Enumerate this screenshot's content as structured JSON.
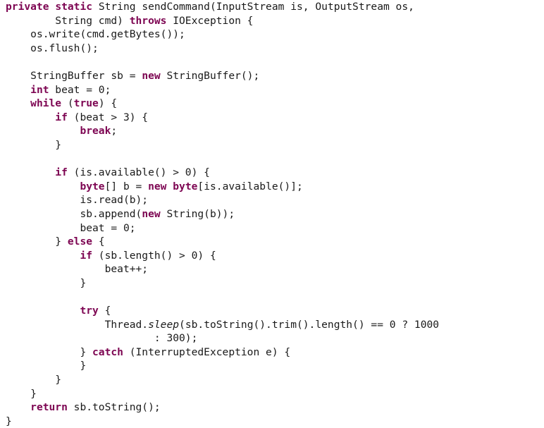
{
  "editor": {
    "language": "java",
    "background_color": "#ffffff",
    "text_color": "#1a1a1a",
    "keyword_color": "#7d0552",
    "font_size_px": 14.6,
    "line_height_px": 19.6
  },
  "code": {
    "lines": [
      {
        "indent": 0,
        "tokens": [
          {
            "t": "kw",
            "s": "private"
          },
          {
            "t": "plain",
            "s": " "
          },
          {
            "t": "kw",
            "s": "static"
          },
          {
            "t": "plain",
            "s": " String sendCommand(InputStream is, OutputStream os,"
          }
        ]
      },
      {
        "indent": 8,
        "tokens": [
          {
            "t": "plain",
            "s": "String cmd) "
          },
          {
            "t": "kw",
            "s": "throws"
          },
          {
            "t": "plain",
            "s": " IOException {"
          }
        ]
      },
      {
        "indent": 4,
        "tokens": [
          {
            "t": "plain",
            "s": "os.write(cmd.getBytes());"
          }
        ]
      },
      {
        "indent": 4,
        "tokens": [
          {
            "t": "plain",
            "s": "os.flush();"
          }
        ]
      },
      {
        "indent": 0,
        "tokens": []
      },
      {
        "indent": 4,
        "tokens": [
          {
            "t": "plain",
            "s": "StringBuffer sb = "
          },
          {
            "t": "kw",
            "s": "new"
          },
          {
            "t": "plain",
            "s": " StringBuffer();"
          }
        ]
      },
      {
        "indent": 4,
        "tokens": [
          {
            "t": "kw",
            "s": "int"
          },
          {
            "t": "plain",
            "s": " beat = 0;"
          }
        ]
      },
      {
        "indent": 4,
        "tokens": [
          {
            "t": "kw",
            "s": "while"
          },
          {
            "t": "plain",
            "s": " ("
          },
          {
            "t": "kw",
            "s": "true"
          },
          {
            "t": "plain",
            "s": ") {"
          }
        ]
      },
      {
        "indent": 8,
        "tokens": [
          {
            "t": "kw",
            "s": "if"
          },
          {
            "t": "plain",
            "s": " (beat > 3) {"
          }
        ]
      },
      {
        "indent": 12,
        "tokens": [
          {
            "t": "kw",
            "s": "break"
          },
          {
            "t": "plain",
            "s": ";"
          }
        ]
      },
      {
        "indent": 8,
        "tokens": [
          {
            "t": "plain",
            "s": "}"
          }
        ]
      },
      {
        "indent": 0,
        "tokens": []
      },
      {
        "indent": 8,
        "tokens": [
          {
            "t": "kw",
            "s": "if"
          },
          {
            "t": "plain",
            "s": " (is.available() > 0) {"
          }
        ]
      },
      {
        "indent": 12,
        "tokens": [
          {
            "t": "kw",
            "s": "byte"
          },
          {
            "t": "plain",
            "s": "[] b = "
          },
          {
            "t": "kw",
            "s": "new"
          },
          {
            "t": "plain",
            "s": " "
          },
          {
            "t": "kw",
            "s": "byte"
          },
          {
            "t": "plain",
            "s": "[is.available()];"
          }
        ]
      },
      {
        "indent": 12,
        "tokens": [
          {
            "t": "plain",
            "s": "is.read(b);"
          }
        ]
      },
      {
        "indent": 12,
        "tokens": [
          {
            "t": "plain",
            "s": "sb.append("
          },
          {
            "t": "kw",
            "s": "new"
          },
          {
            "t": "plain",
            "s": " String(b));"
          }
        ]
      },
      {
        "indent": 12,
        "tokens": [
          {
            "t": "plain",
            "s": "beat = 0;"
          }
        ]
      },
      {
        "indent": 8,
        "tokens": [
          {
            "t": "plain",
            "s": "} "
          },
          {
            "t": "kw",
            "s": "else"
          },
          {
            "t": "plain",
            "s": " {"
          }
        ]
      },
      {
        "indent": 12,
        "tokens": [
          {
            "t": "kw",
            "s": "if"
          },
          {
            "t": "plain",
            "s": " (sb.length() > 0) {"
          }
        ]
      },
      {
        "indent": 16,
        "tokens": [
          {
            "t": "plain",
            "s": "beat++;"
          }
        ]
      },
      {
        "indent": 12,
        "tokens": [
          {
            "t": "plain",
            "s": "}"
          }
        ]
      },
      {
        "indent": 0,
        "tokens": []
      },
      {
        "indent": 12,
        "tokens": [
          {
            "t": "kw",
            "s": "try"
          },
          {
            "t": "plain",
            "s": " {"
          }
        ]
      },
      {
        "indent": 16,
        "tokens": [
          {
            "t": "plain",
            "s": "Thread."
          },
          {
            "t": "ital",
            "s": "sleep"
          },
          {
            "t": "plain",
            "s": "(sb.toString().trim().length() == 0 ? 1000"
          }
        ]
      },
      {
        "indent": 24,
        "tokens": [
          {
            "t": "plain",
            "s": ": 300);"
          }
        ]
      },
      {
        "indent": 12,
        "tokens": [
          {
            "t": "plain",
            "s": "} "
          },
          {
            "t": "kw",
            "s": "catch"
          },
          {
            "t": "plain",
            "s": " (InterruptedException e) {"
          }
        ]
      },
      {
        "indent": 12,
        "tokens": [
          {
            "t": "plain",
            "s": "}"
          }
        ]
      },
      {
        "indent": 8,
        "tokens": [
          {
            "t": "plain",
            "s": "}"
          }
        ]
      },
      {
        "indent": 4,
        "tokens": [
          {
            "t": "plain",
            "s": "}"
          }
        ]
      },
      {
        "indent": 4,
        "tokens": [
          {
            "t": "kw",
            "s": "return"
          },
          {
            "t": "plain",
            "s": " sb.toString();"
          }
        ]
      },
      {
        "indent": 0,
        "tokens": [
          {
            "t": "plain",
            "s": "}"
          }
        ]
      }
    ]
  }
}
